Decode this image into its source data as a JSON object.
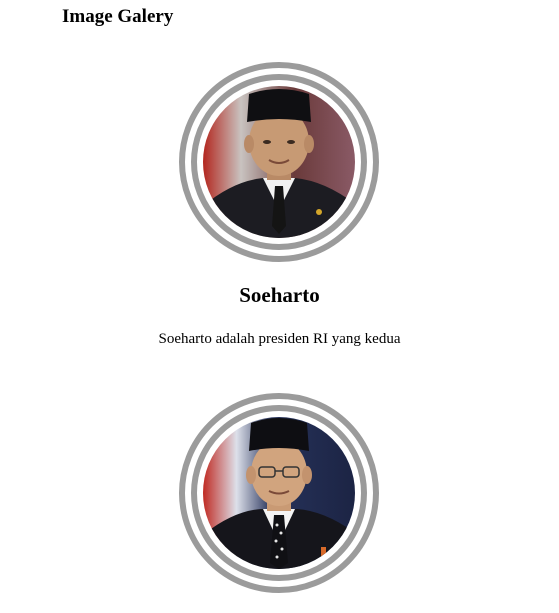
{
  "page": {
    "title": "Image Galery"
  },
  "gallery": [
    {
      "name": "Soeharto",
      "description": "Soeharto adalah presiden RI yang kedua"
    },
    {
      "name": "",
      "description": ""
    }
  ],
  "colors": {
    "ring": "#9b9b9b",
    "background": "#ffffff",
    "text": "#000000"
  }
}
